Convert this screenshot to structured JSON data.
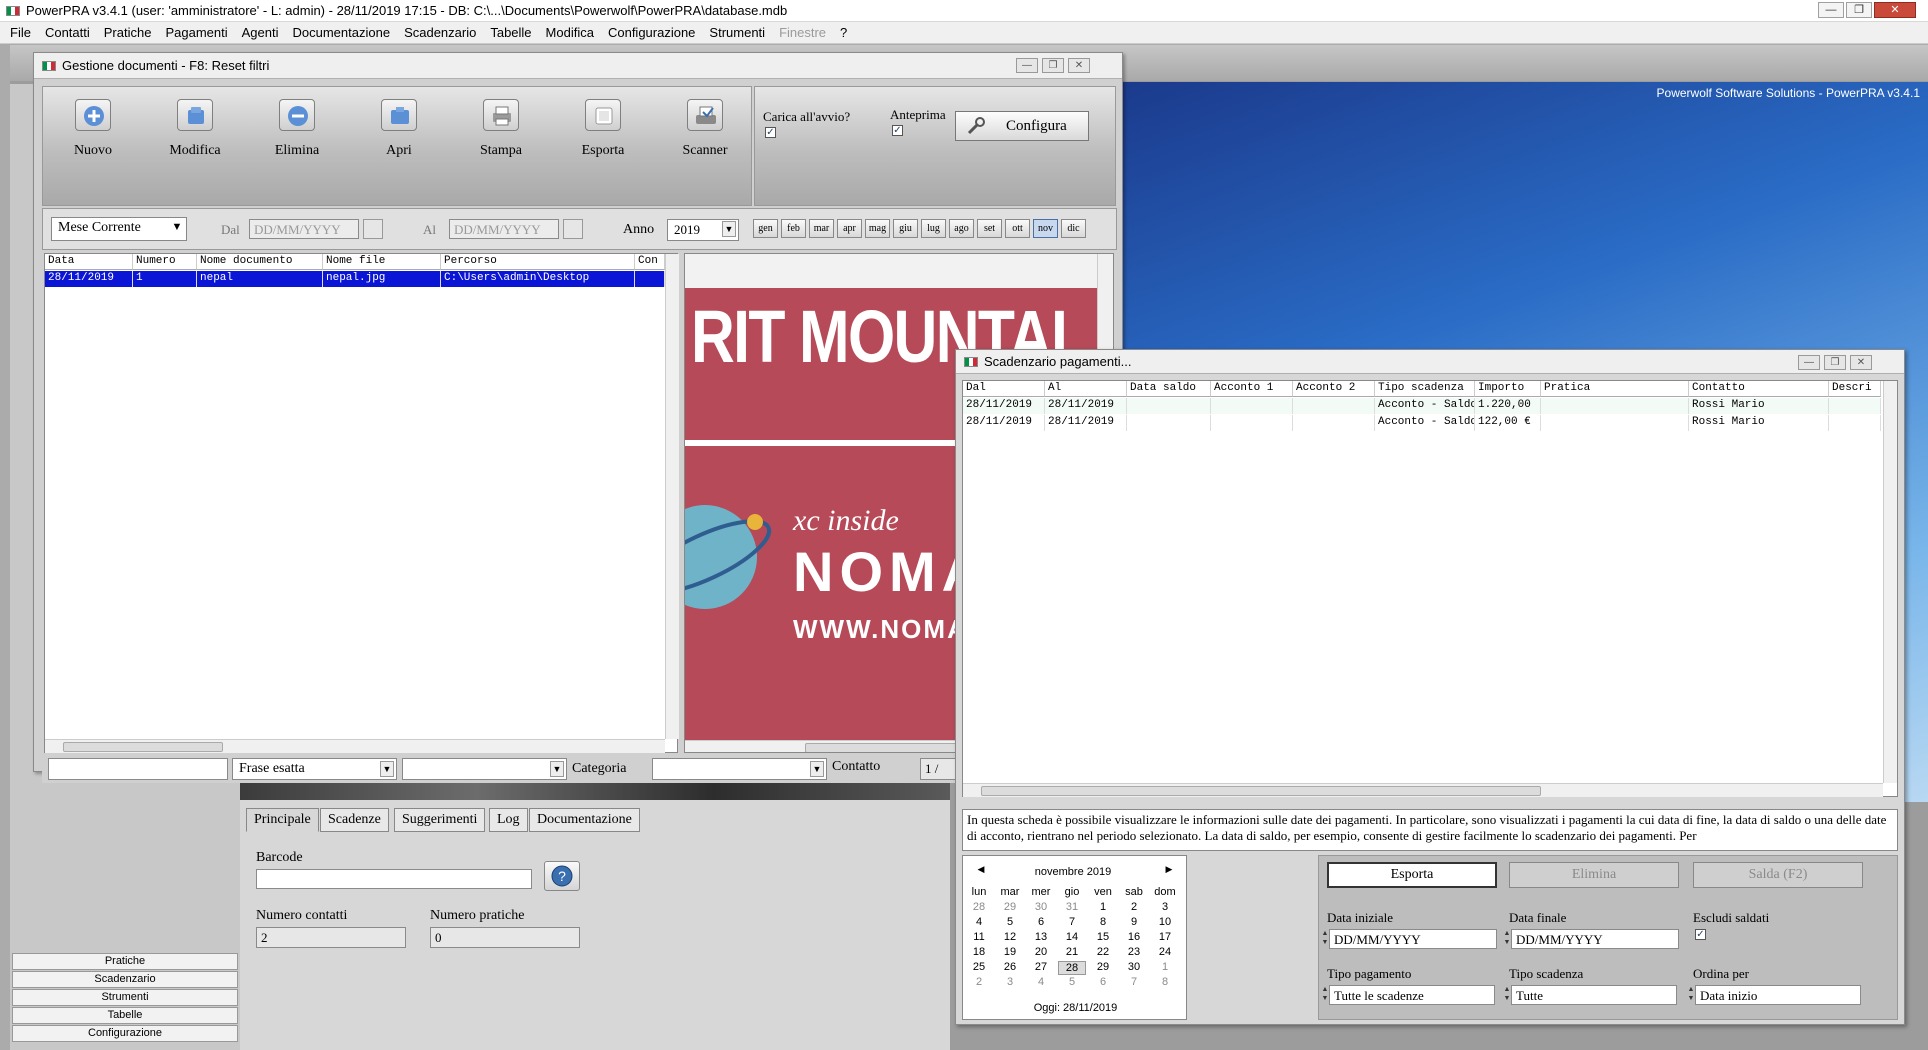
{
  "app": {
    "title": "PowerPRA v3.4.1  (user: 'amministratore'  - L: admin) - 28/11/2019 17:15 - DB: C:\\...\\Documents\\Powerwolf\\PowerPRA\\database.mdb",
    "brand": "Powerwolf Software Solutions - PowerPRA v3.4.1",
    "menu": [
      "File",
      "Contatti",
      "Pratiche",
      "Pagamenti",
      "Agenti",
      "Documentazione",
      "Scadenzario",
      "Tabelle",
      "Modifica",
      "Configurazione",
      "Strumenti",
      "Finestre",
      "?"
    ]
  },
  "left_nav": [
    "Pratiche",
    "Scadenzario",
    "Strumenti",
    "Tabelle",
    "Configurazione"
  ],
  "detail": {
    "tabs": [
      "Principale",
      "Scadenze",
      "Suggerimenti",
      "Log",
      "Documentazione"
    ],
    "barcode_label": "Barcode",
    "barcode_value": "",
    "numero_contatti_label": "Numero contatti",
    "numero_contatti": "2",
    "numero_pratiche_label": "Numero pratiche",
    "numero_pratiche": "0"
  },
  "docs": {
    "title": "Gestione documenti - F8: Reset filtri",
    "toolbar": [
      "Nuovo",
      "Modifica",
      "Elimina",
      "Apri",
      "Stampa",
      "Esporta",
      "Scanner"
    ],
    "carica_label": "Carica all'avvio?",
    "anteprima_label": "Anteprima",
    "configura_label": "Configura",
    "period": "Mese Corrente",
    "dal_label": "Dal",
    "al_label": "Al",
    "date_placeholder": "DD/MM/YYYY",
    "anno_label": "Anno",
    "anno": "2019",
    "months": [
      "gen",
      "feb",
      "mar",
      "apr",
      "mag",
      "giu",
      "lug",
      "ago",
      "set",
      "ott",
      "nov",
      "dic"
    ],
    "selected_month": "nov",
    "columns": [
      "Data",
      "Numero",
      "Nome documento",
      "Nome file",
      "Percorso",
      "Con"
    ],
    "rows": [
      [
        "28/11/2019",
        "1",
        "nepal",
        "nepal.jpg",
        "C:\\Users\\admin\\Desktop",
        ""
      ]
    ],
    "search_mode": "Frase esatta",
    "categoria_label": "Categoria",
    "contatto_label": "Contatto",
    "page": "1 /",
    "preview_text_1": "RIT MOUNTAI",
    "preview_text_2": "xc inside",
    "preview_text_3": "NOMA",
    "preview_text_4": "WWW.NOMAD"
  },
  "pay": {
    "title": "Scadenzario pagamenti...",
    "columns": [
      "Dal",
      "Al",
      "Data saldo",
      "Acconto 1",
      "Acconto 2",
      "Tipo scadenza",
      "Importo",
      "Pratica",
      "Contatto",
      "Descri"
    ],
    "rows": [
      [
        "28/11/2019",
        "28/11/2019",
        "",
        "",
        "",
        "Acconto - Saldo",
        "1.220,00",
        "",
        "Rossi Mario",
        ""
      ],
      [
        "28/11/2019",
        "28/11/2019",
        "",
        "",
        "",
        "Acconto - Saldo",
        "122,00 €",
        "",
        "Rossi Mario",
        ""
      ]
    ],
    "info": "In questa scheda è possibile visualizzare le informazioni sulle date dei pagamenti. In particolare, sono visualizzati i pagamenti la cui data di fine, la data di saldo o una delle date di acconto, rientrano nel periodo selezionato. La data di saldo, per esempio, consente di gestire facilmente lo scadenzario dei pagamenti. Per",
    "calendar": {
      "month": "novembre 2019",
      "weekdays": [
        "lun",
        "mar",
        "mer",
        "gio",
        "ven",
        "sab",
        "dom"
      ],
      "weeks": [
        [
          "28",
          "29",
          "30",
          "31",
          "1",
          "2",
          "3"
        ],
        [
          "4",
          "5",
          "6",
          "7",
          "8",
          "9",
          "10"
        ],
        [
          "11",
          "12",
          "13",
          "14",
          "15",
          "16",
          "17"
        ],
        [
          "18",
          "19",
          "20",
          "21",
          "22",
          "23",
          "24"
        ],
        [
          "25",
          "26",
          "27",
          "28",
          "29",
          "30",
          "1"
        ],
        [
          "2",
          "3",
          "4",
          "5",
          "6",
          "7",
          "8"
        ]
      ],
      "today": "Oggi: 28/11/2019"
    },
    "buttons": [
      "Esporta",
      "Elimina",
      "Salda (F2)"
    ],
    "data_iniziale_label": "Data iniziale",
    "data_finale_label": "Data finale",
    "escludi_label": "Escludi saldati",
    "tipo_pagamento_label": "Tipo pagamento",
    "tipo_pagamento": "Tutte le scadenze",
    "tipo_scadenza_label": "Tipo scadenza",
    "tipo_scadenza": "Tutte",
    "ordina_label": "Ordina per",
    "ordina": "Data inizio",
    "date_placeholder": "DD/MM/YYYY"
  }
}
